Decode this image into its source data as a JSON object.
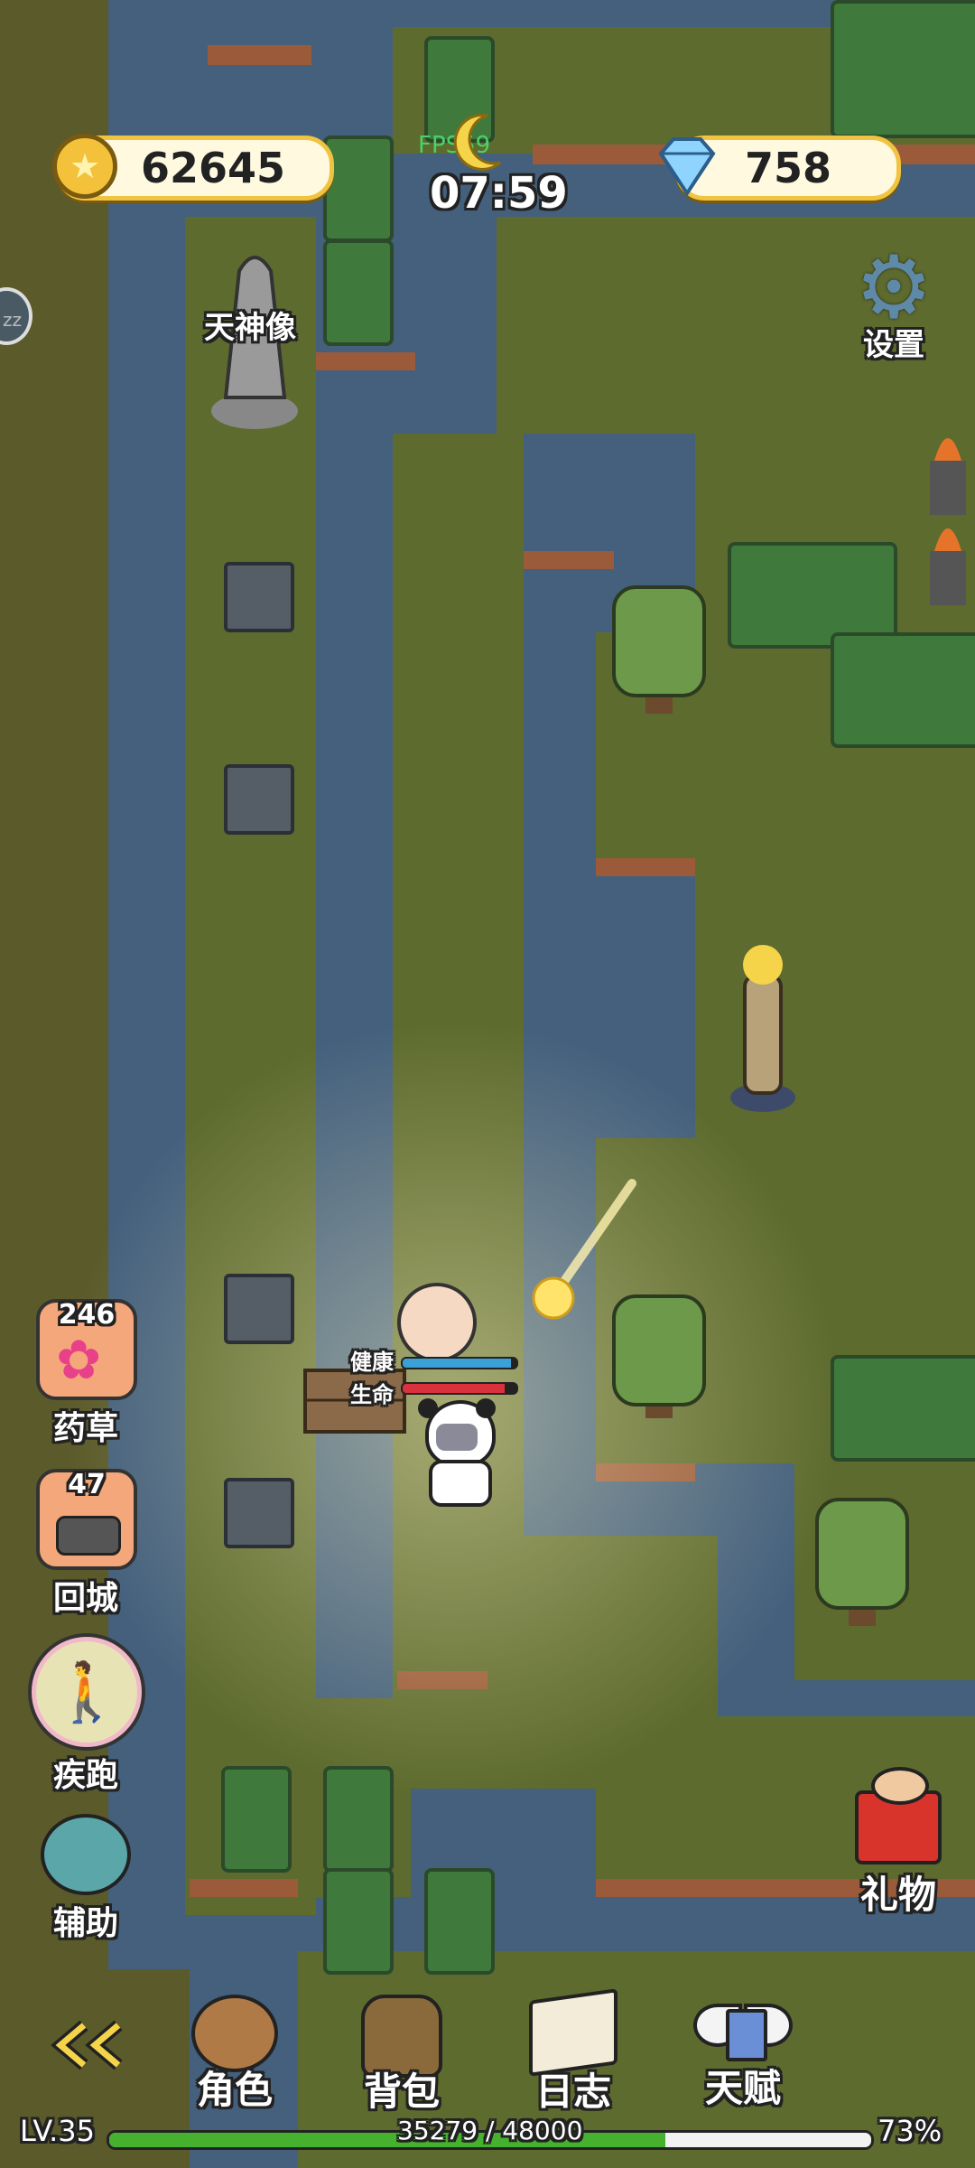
{
  "hud": {
    "gold": "62645",
    "gems": "758",
    "fps": "FPS59",
    "clock": "07:59",
    "settings_label": "设置"
  },
  "map_labels": {
    "statue": "天神像"
  },
  "player": {
    "health_label": "健康",
    "life_label": "生命",
    "health_ratio": 0.95,
    "life_ratio": 0.9
  },
  "side_menu": {
    "herb": {
      "label": "药草",
      "count": "246"
    },
    "return": {
      "label": "回城",
      "count": "47"
    },
    "sprint": {
      "label": "疾跑"
    },
    "assist": {
      "label": "辅助"
    }
  },
  "gift": {
    "label": "礼物"
  },
  "bottom_nav": {
    "back_icon": "double-chevron-left-icon",
    "character": "角色",
    "bag": "背包",
    "journal": "日志",
    "talent": "天赋"
  },
  "level": {
    "label": "LV.35",
    "xp": "35279 / 48000",
    "percent": "73%",
    "xp_ratio": 0.73
  },
  "colors": {
    "water": "#3f5b78",
    "grass": "#5e6b2e",
    "hedge": "#3f7a3c",
    "gold_border": "#f0c341",
    "health": "#3aa0d6",
    "life": "#d9323c",
    "xp": "#45b12e"
  }
}
